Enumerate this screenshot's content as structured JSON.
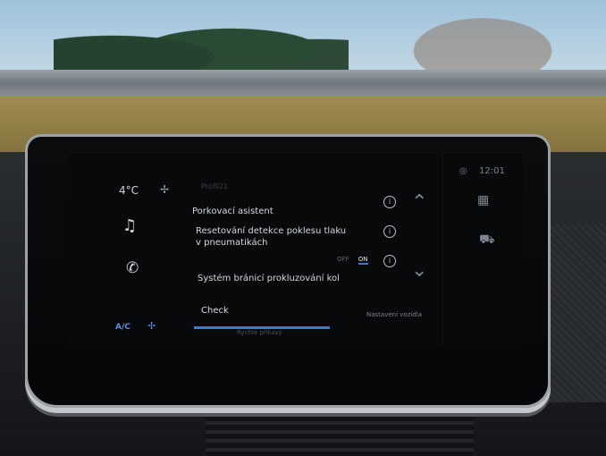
{
  "status": {
    "temperature": "4°C",
    "profile": "Profil21",
    "clock": "12:01"
  },
  "settings": {
    "rows": [
      {
        "label": "Porkovací asistent"
      },
      {
        "label": "Resetování detekce poklesu tlaku v pneumatikách"
      },
      {
        "label": "Systém bránicí prokluzování kol"
      }
    ],
    "toggle": {
      "off": "OFF",
      "on": "ON",
      "selected": "ON"
    },
    "check_label": "Check",
    "settings_tab": "Nastavení vozidla",
    "quick_tab": "Rychlé příkazy"
  },
  "climate": {
    "ac_label": "A/C"
  },
  "icons": {
    "music": "music-note-icon",
    "phone": "phone-icon",
    "fan": "fan-icon",
    "gps": "gps-icon",
    "grid": "grid-icon",
    "car": "car-icon",
    "up": "chevron-up-icon",
    "down": "chevron-down-icon",
    "info": "info-icon"
  },
  "colors": {
    "accent": "#3c78d8"
  }
}
